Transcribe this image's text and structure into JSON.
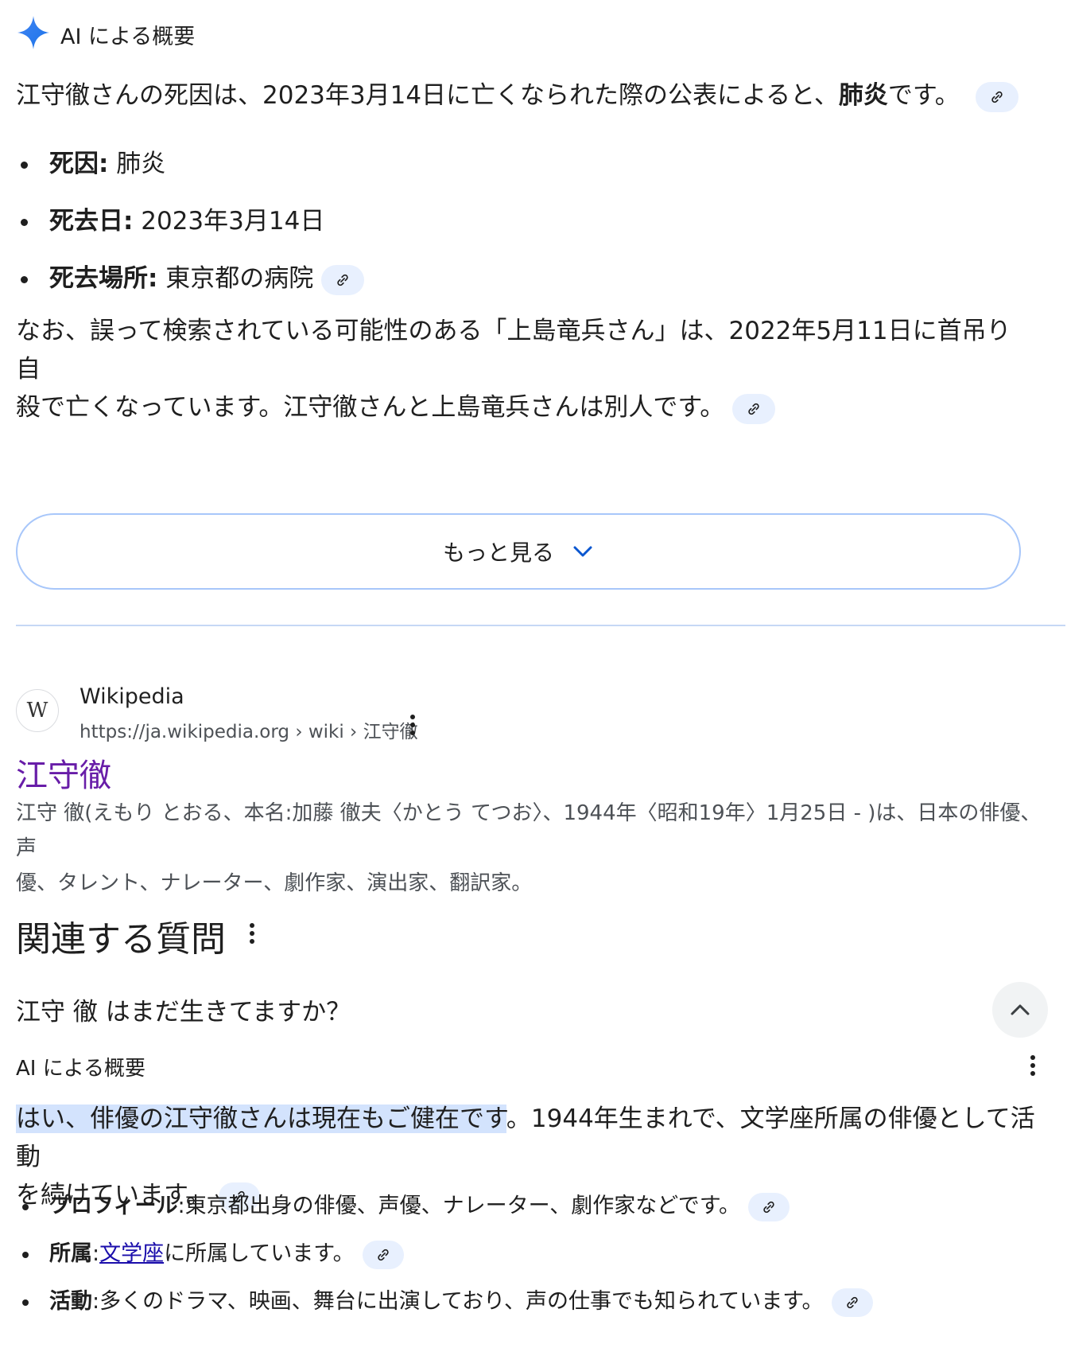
{
  "ai_overview": {
    "title": "AI による概要",
    "summary_pre": "江守徹さんの死因は、2023年3月14日に亡くなられた際の公表によると、",
    "summary_bold": "肺炎",
    "summary_post": "です。",
    "facts": [
      {
        "label": "死因:",
        "value": " 肺炎",
        "has_link": false
      },
      {
        "label": "死去日:",
        "value": " 2023年3月14日",
        "has_link": false
      },
      {
        "label": "死去場所:",
        "value": " 東京都の病院",
        "has_link": true
      }
    ],
    "note_line1": "なお、誤って検索されている可能性のある「上島竜兵さん」は、2022年5月11日に首吊り自",
    "note_line2": "殺で亡くなっています。江守徹さんと上島竜兵さんは別人です。",
    "show_more": "もっと見る"
  },
  "result": {
    "site_name": "Wikipedia",
    "url": "https://ja.wikipedia.org › wiki › 江守徹",
    "favicon_letter": "W",
    "title": "江守徹",
    "snippet_line1": "江守 徹(えもり とおる、本名:加藤 徹夫〈かとう てつお〉、1944年〈昭和19年〉1月25日 - )は、日本の俳優、声",
    "snippet_line2": "優、タレント、ナレーター、劇作家、演出家、翻訳家。"
  },
  "related": {
    "title": "関連する質問",
    "question": "江守 徹 はまだ生きてますか？",
    "ai_title": "AI による概要",
    "answer_highlight": "はい、俳優の江守徹さんは現在もご健在です",
    "answer_rest_line1": "。1944年生まれで、文学座所属の俳優として活動",
    "answer_line2": "を続けています。",
    "details": [
      {
        "label": "プロフィール",
        "text": ":東京都出身の俳優、声優、ナレーター、劇作家などです。"
      },
      {
        "label": "所属",
        "text_pre": ":",
        "link": "文学座",
        "text_post": "に所属しています。"
      },
      {
        "label": "活動",
        "text": ":多くのドラマ、映画、舞台に出演しており、声の仕事でも知られています。"
      }
    ]
  },
  "colors": {
    "accent_blue": "#1a73e8",
    "visited_title": "#681da8",
    "chip_bg": "#e8f0fe",
    "highlight": "#d3e3fd"
  },
  "icons": [
    "gemini-sparkle-icon",
    "link-icon",
    "chevron-down-icon",
    "more-vert-icon",
    "chevron-up-icon"
  ]
}
